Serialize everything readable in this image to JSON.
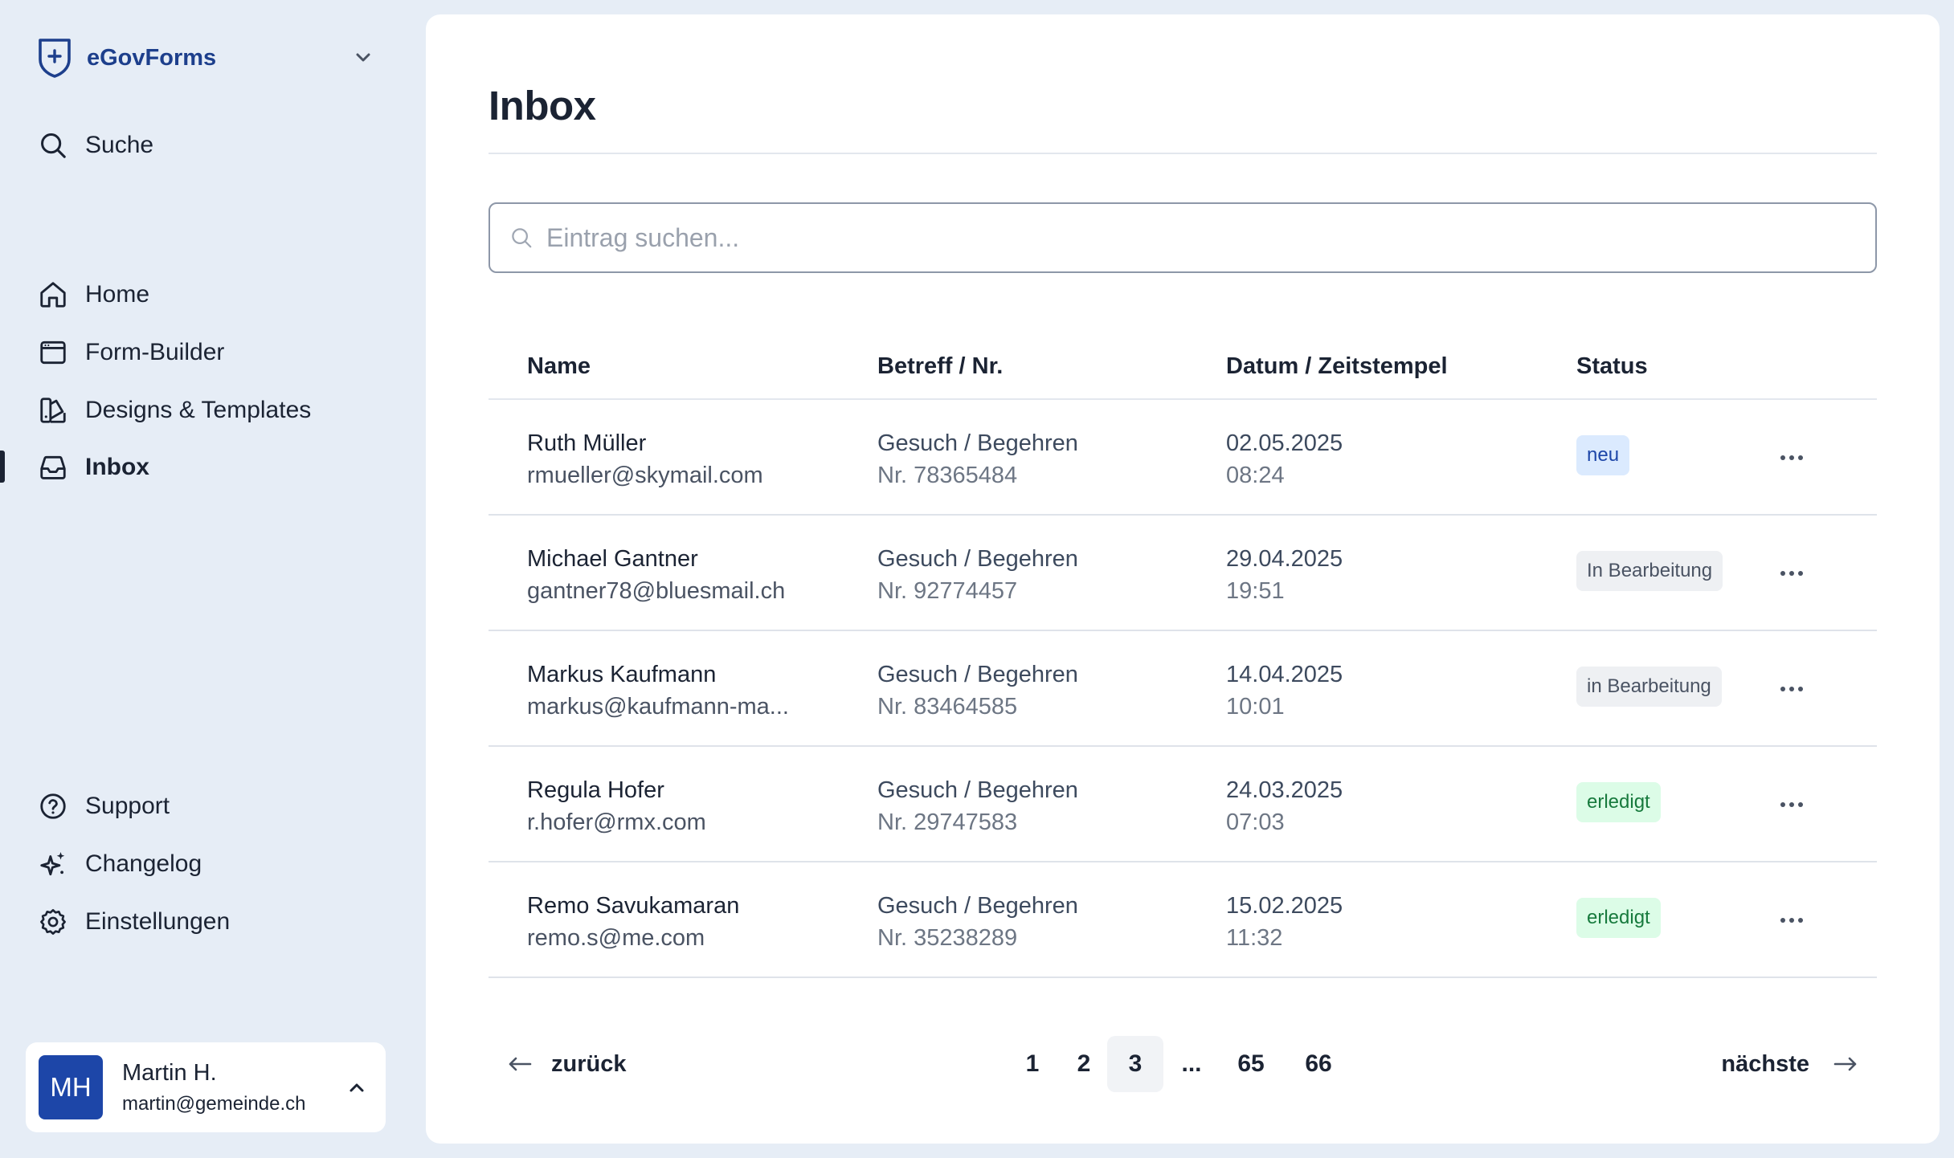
{
  "app": {
    "name": "eGovForms",
    "logo_icon": "shield-plus-icon",
    "switch_icon": "chevron-down-icon"
  },
  "sidebar": {
    "search": {
      "label": "Suche",
      "icon": "search-icon"
    },
    "nav": [
      {
        "label": "Home",
        "icon": "home-icon",
        "active": false
      },
      {
        "label": "Form-Builder",
        "icon": "browser-window-icon",
        "active": false
      },
      {
        "label": "Designs & Templates",
        "icon": "palette-icon",
        "active": false
      },
      {
        "label": "Inbox",
        "icon": "inbox-icon",
        "active": true
      }
    ],
    "secondary": [
      {
        "label": "Support",
        "icon": "help-circle-icon"
      },
      {
        "label": "Changelog",
        "icon": "sparkles-icon"
      },
      {
        "label": "Einstellungen",
        "icon": "gear-icon"
      }
    ],
    "user": {
      "initials": "MH",
      "name": "Martin H.",
      "email": "martin@gemeinde.ch",
      "menu_icon": "chevron-up-icon"
    }
  },
  "page": {
    "title": "Inbox",
    "search": {
      "placeholder": "Eintrag suchen...",
      "value": ""
    }
  },
  "table": {
    "headers": {
      "name": "Name",
      "subject": "Betreff / Nr.",
      "date": "Datum / Zeitstempel",
      "status": "Status"
    },
    "rows": [
      {
        "name": "Ruth Müller",
        "email": "rmueller@skymail.com",
        "subject": "Gesuch / Begehren",
        "number": "Nr. 78365484",
        "date": "02.05.2025",
        "time": "08:24",
        "status": "neu",
        "status_type": "new"
      },
      {
        "name": "Michael Gantner",
        "email": "gantner78@bluesmail.ch",
        "subject": "Gesuch / Begehren",
        "number": "Nr. 92774457",
        "date": "29.04.2025",
        "time": "19:51",
        "status": "In Bearbeitung",
        "status_type": "progress"
      },
      {
        "name": "Markus Kaufmann",
        "email": "markus@kaufmann-ma...",
        "subject": "Gesuch / Begehren",
        "number": "Nr. 83464585",
        "date": "14.04.2025",
        "time": "10:01",
        "status": "in Bearbeitung",
        "status_type": "progress"
      },
      {
        "name": "Regula Hofer",
        "email": "r.hofer@rmx.com",
        "subject": "Gesuch / Begehren",
        "number": "Nr. 29747583",
        "date": "24.03.2025",
        "time": "07:03",
        "status": "erledigt",
        "status_type": "done"
      },
      {
        "name": "Remo Savukamaran",
        "email": "remo.s@me.com",
        "subject": "Gesuch / Begehren",
        "number": "Nr. 35238289",
        "date": "15.02.2025",
        "time": "11:32",
        "status": "erledigt",
        "status_type": "done"
      }
    ],
    "row_menu_icon": "more-horizontal-icon"
  },
  "pagination": {
    "prev": "zurück",
    "next": "nächste",
    "pages": [
      "1",
      "2",
      "3",
      "...",
      "65",
      "66"
    ],
    "current": "3"
  },
  "colors": {
    "brand": "#1d3f8c",
    "avatar": "#1d46a8",
    "sidebar_bg": "#e6edf6",
    "badge_new_bg": "#dbeafe",
    "badge_done_bg": "#dcfce7",
    "badge_progress_bg": "#eef0f3"
  }
}
